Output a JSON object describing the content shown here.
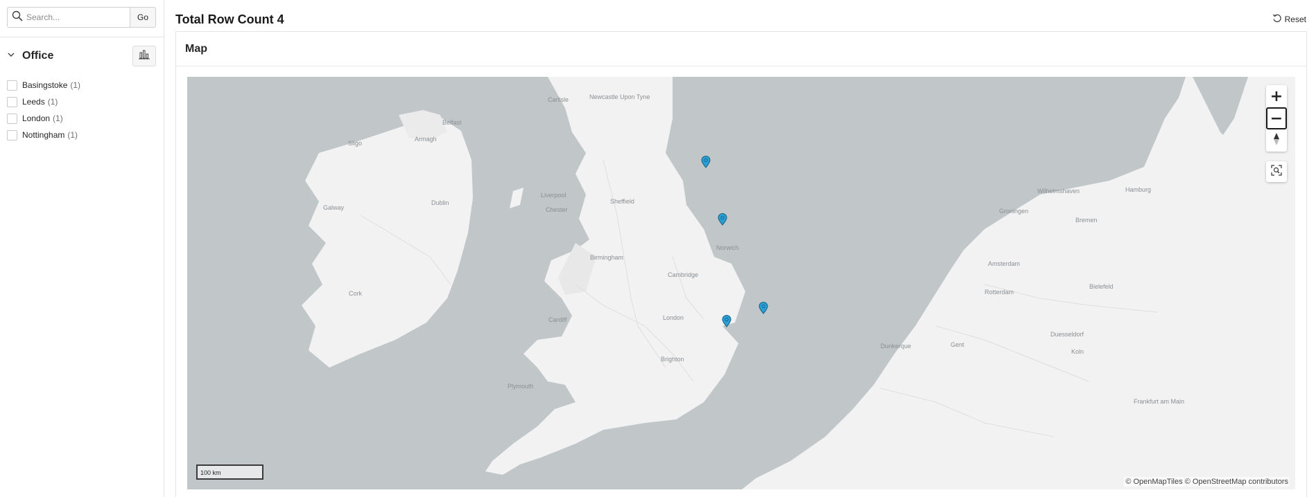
{
  "search": {
    "placeholder": "Search...",
    "go_label": "Go"
  },
  "facet": {
    "title": "Office",
    "items": [
      {
        "label": "Basingstoke",
        "count": "(1)"
      },
      {
        "label": "Leeds",
        "count": "(1)"
      },
      {
        "label": "London",
        "count": "(1)"
      },
      {
        "label": "Nottingham",
        "count": "(1)"
      }
    ]
  },
  "header": {
    "row_count": "Total Row Count 4",
    "reset_label": "Reset"
  },
  "region": {
    "title": "Map"
  },
  "map": {
    "labels": [
      "Newcastle Upon Tyne",
      "Carlisle",
      "Belfast",
      "Armagh",
      "Sligo",
      "Liverpool",
      "Sheffield",
      "Chester",
      "Dublin",
      "Galway",
      "Birmingham",
      "Norwich",
      "Cambridge",
      "London",
      "Cardiff",
      "Cork",
      "Brighton",
      "Plymouth",
      "Wilhelmshaven",
      "Hamburg",
      "Groningen",
      "Bremen",
      "Amsterdam",
      "Rotterdam",
      "Bielefeld",
      "Dunkerque",
      "Gent",
      "Duesseldorf",
      "Koln",
      "Frankfurt am Main"
    ],
    "zoom_in": "+",
    "zoom_out": "−",
    "scale_label": "100 km",
    "attribution": "© OpenMapTiles  © OpenStreetMap contributors"
  },
  "colors": {
    "sea": "#c1c6c9",
    "land": "#f2f2f2",
    "marker": "#2a9fd6"
  }
}
